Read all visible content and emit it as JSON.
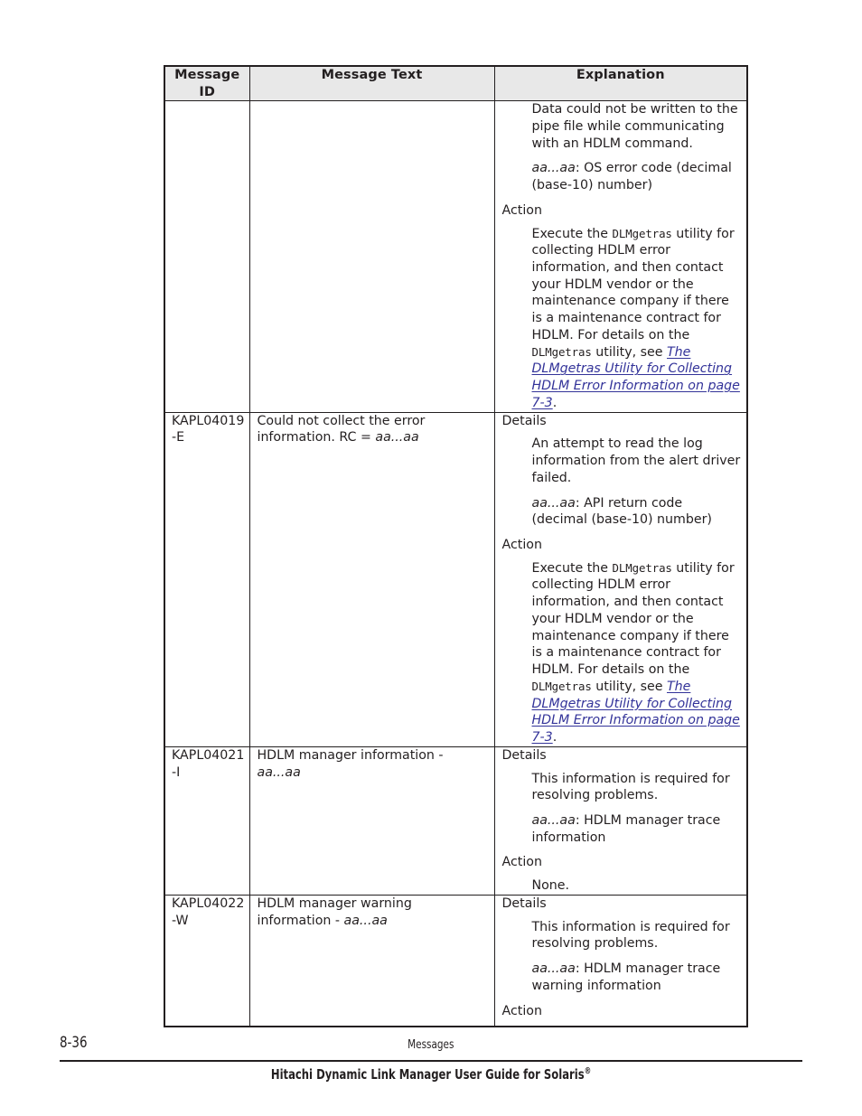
{
  "table": {
    "headers": {
      "id": "Message ID",
      "id_line1": "Message",
      "id_line2": "ID",
      "text": "Message Text",
      "explanation": "Explanation"
    },
    "rows": [
      {
        "id": "",
        "message_text": "",
        "continued_from_previous_page": true,
        "explanation": {
          "details_label": "",
          "details_paragraphs": [
            "Data could not be written to the pipe file while communicating with an HDLM command."
          ],
          "variable_note_var": "aa...aa",
          "variable_note_text": ": OS error code (decimal (base-10) number)",
          "action_label": "Action",
          "action_intro": "Execute the ",
          "action_mono1": "DLMgetras",
          "action_mid": " utility for collecting HDLM error information, and then contact your HDLM vendor or the maintenance company if there is a maintenance contract for HDLM. For details on the ",
          "action_mono2": "DLMgetras",
          "action_tail": " utility, see ",
          "action_link": "The DLMgetras Utility for Collecting HDLM Error Information on page 7-3",
          "action_period": "."
        }
      },
      {
        "id": "KAPL04019-E",
        "id_line1": "KAPL04019",
        "id_line2": "-E",
        "message_text_prefix": "Could not collect the error information. RC = ",
        "message_text_var": "aa...aa",
        "explanation": {
          "details_label": "Details",
          "details_paragraphs": [
            "An attempt to read the log information from the alert driver failed."
          ],
          "variable_note_var": "aa...aa",
          "variable_note_text": ": API return code (decimal (base-10) number)",
          "action_label": "Action",
          "action_intro": "Execute the ",
          "action_mono1": "DLMgetras",
          "action_mid": " utility for collecting HDLM error information, and then contact your HDLM vendor or the maintenance company if there is a maintenance contract for HDLM. For details on the ",
          "action_mono2": "DLMgetras",
          "action_tail": " utility, see ",
          "action_link": "The DLMgetras Utility for Collecting HDLM Error Information on page 7-3",
          "action_period": "."
        }
      },
      {
        "id": "KAPL04021-I",
        "id_line1": "KAPL04021",
        "id_line2": "-I",
        "message_text_prefix": "HDLM manager information - ",
        "message_text_var": "aa...aa",
        "explanation": {
          "details_label": "Details",
          "details_paragraphs": [
            "This information is required for resolving problems."
          ],
          "variable_note_var": "aa...aa",
          "variable_note_text": ": HDLM manager trace information",
          "action_label": "Action",
          "action_body": "None."
        }
      },
      {
        "id": "KAPL04022-W",
        "id_line1": "KAPL04022",
        "id_line2": "-W",
        "message_text_prefix": "HDLM manager warning information - ",
        "message_text_var": "aa...aa",
        "explanation": {
          "details_label": "Details",
          "details_paragraphs": [
            "This information is required for resolving problems."
          ],
          "variable_note_var": "aa...aa",
          "variable_note_text": ": HDLM manager trace warning information",
          "action_label": "Action",
          "action_body": ""
        }
      }
    ]
  },
  "footer": {
    "page_number": "8-36",
    "chapter": "Messages",
    "book_title": "Hitachi Dynamic Link Manager User Guide for Solaris",
    "registered_mark": "®"
  }
}
